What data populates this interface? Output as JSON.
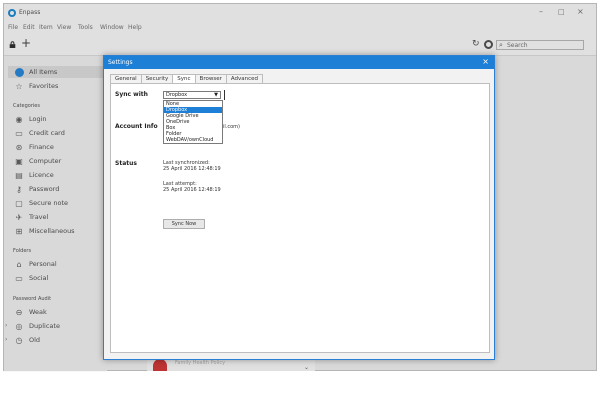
{
  "app": {
    "title": "Enpass",
    "brand_color": "#1f8fd8"
  },
  "window_controls": {
    "minimize": "–",
    "maximize": "□",
    "close": "×"
  },
  "menu": [
    "File",
    "Edit",
    "Item",
    "View",
    "Tools",
    "Window",
    "Help"
  ],
  "toolbar": {
    "search_placeholder": "Search",
    "search_icon": "⌕",
    "sync_icon": "↻",
    "add_icon": "+"
  },
  "sidebar": {
    "top_items": [
      {
        "label": "All Items",
        "icon": "info-icon"
      },
      {
        "label": "Favorites",
        "icon": "star-icon"
      }
    ],
    "categories_heading": "Categories",
    "categories": [
      {
        "label": "Login",
        "icon": "globe-icon",
        "glyph": "◉"
      },
      {
        "label": "Credit card",
        "icon": "credit-card-icon",
        "glyph": "▭"
      },
      {
        "label": "Finance",
        "icon": "finance-icon",
        "glyph": "⊛"
      },
      {
        "label": "Computer",
        "icon": "computer-icon",
        "glyph": "▣"
      },
      {
        "label": "Licence",
        "icon": "licence-icon",
        "glyph": "▤"
      },
      {
        "label": "Password",
        "icon": "key-icon",
        "glyph": "⚷"
      },
      {
        "label": "Secure note",
        "icon": "note-icon",
        "glyph": "▢"
      },
      {
        "label": "Travel",
        "icon": "plane-icon",
        "glyph": "✈"
      },
      {
        "label": "Miscellaneous",
        "icon": "misc-icon",
        "glyph": "⊞"
      }
    ],
    "folders_heading": "Folders",
    "folders": [
      {
        "label": "Personal",
        "icon": "home-icon",
        "glyph": "⌂"
      },
      {
        "label": "Social",
        "icon": "folder-icon",
        "glyph": "▭"
      }
    ],
    "audit_heading": "Password Audit",
    "audit": [
      {
        "label": "Weak",
        "icon": "weak-icon",
        "glyph": "⊖"
      },
      {
        "label": "Duplicate",
        "icon": "duplicate-icon",
        "glyph": "◎"
      },
      {
        "label": "Old",
        "icon": "clock-icon",
        "glyph": "◷"
      }
    ]
  },
  "list_hint": {
    "text": "Family Health Policy"
  },
  "dialog": {
    "title": "Settings",
    "close": "×",
    "accent_color": "#1d7fd6",
    "tabs": [
      "General",
      "Security",
      "Sync",
      "Browser",
      "Advanced"
    ],
    "active_tab": "Sync",
    "sync_with_label": "Sync with",
    "sync_with_value": "Dropbox",
    "sync_options": [
      "None",
      "Dropbox",
      "Google Drive",
      "OneDrive",
      "Box",
      "Folder",
      "WebDAV/ownCloud"
    ],
    "selected_option": "Dropbox",
    "account_info_label": "Account Info",
    "account_info_value": "il.com)",
    "status_label": "Status",
    "last_synchronized_label": "Last synchronized:",
    "last_synchronized_value": "25 April 2016 12:48:19",
    "last_attempt_label": "Last attempt:",
    "last_attempt_value": "25 April 2016 12:48:19",
    "sync_now_button": "Sync Now"
  }
}
